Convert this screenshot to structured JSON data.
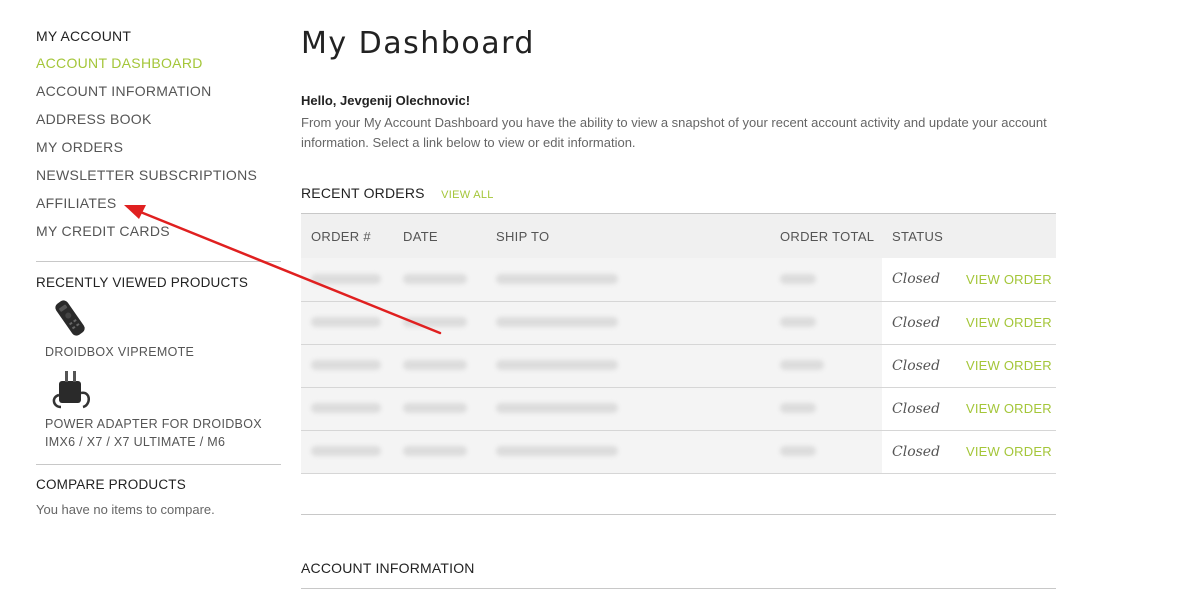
{
  "sidebar": {
    "title": "MY ACCOUNT",
    "nav": [
      {
        "label": "ACCOUNT DASHBOARD",
        "active": true
      },
      {
        "label": "ACCOUNT INFORMATION"
      },
      {
        "label": "ADDRESS BOOK"
      },
      {
        "label": "MY ORDERS"
      },
      {
        "label": "NEWSLETTER SUBSCRIPTIONS"
      },
      {
        "label": "AFFILIATES"
      },
      {
        "label": "MY CREDIT CARDS"
      }
    ],
    "recently_viewed": {
      "title": "RECENTLY VIEWED PRODUCTS",
      "items": [
        {
          "name": "DROIDBOX VIPREMOTE"
        },
        {
          "name": "POWER ADAPTER FOR DROIDBOX IMX6 / X7 / X7 ULTIMATE / M6"
        }
      ]
    },
    "compare": {
      "title": "COMPARE PRODUCTS",
      "text": "You have no items to compare."
    }
  },
  "main": {
    "title": "My Dashboard",
    "greeting": "Hello, Jevgenij Olechnovic!",
    "intro": "From your My Account Dashboard you have the ability to view a snapshot of your recent account activity and update your account information. Select a link below to view or edit information.",
    "recent_orders": {
      "label": "RECENT ORDERS",
      "view_all": "VIEW ALL",
      "columns": [
        "ORDER #",
        "DATE",
        "SHIP TO",
        "ORDER TOTAL",
        "STATUS",
        ""
      ],
      "rows": [
        {
          "status": "Closed",
          "action": "VIEW ORDER"
        },
        {
          "status": "Closed",
          "action": "VIEW ORDER"
        },
        {
          "status": "Closed",
          "action": "VIEW ORDER"
        },
        {
          "status": "Closed",
          "action": "VIEW ORDER"
        },
        {
          "status": "Closed",
          "action": "VIEW ORDER"
        }
      ]
    },
    "account_info": {
      "label": "ACCOUNT INFORMATION"
    }
  },
  "colors": {
    "accent": "#a4c639",
    "annotation_arrow": "#e02020"
  }
}
